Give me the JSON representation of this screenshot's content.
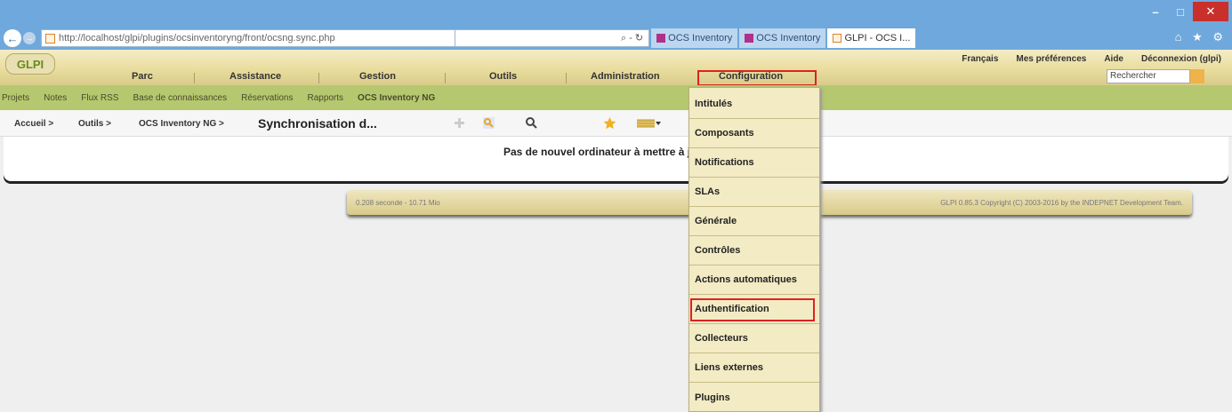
{
  "browser": {
    "url": "http://localhost/glpi/plugins/ocsinventoryng/front/ocsng.sync.php",
    "url_tools": "⌕ - ↻",
    "tabs": [
      "OCS Inventory",
      "OCS Inventory",
      "GLPI - OCS I..."
    ],
    "icons": "⌂ ★ ⚙"
  },
  "header": {
    "logo_text": "GLPI",
    "top_links": [
      "Français",
      "Mes préférences",
      "Aide",
      "Déconnexion (glpi)"
    ],
    "search_placeholder": "Rechercher",
    "main_menu": [
      "Parc",
      "Assistance",
      "Gestion",
      "Outils",
      "Administration",
      "Configuration"
    ]
  },
  "sub_menu": [
    "Projets",
    "Notes",
    "Flux RSS",
    "Base de connaissances",
    "Réservations",
    "Rapports",
    "OCS Inventory NG"
  ],
  "breadcrumb": {
    "items": [
      "Accueil >",
      "Outils >",
      "OCS Inventory NG >"
    ],
    "title": "Synchronisation d..."
  },
  "content": {
    "message": "Pas de nouvel ordinateur à mettre à jour"
  },
  "footer": {
    "left": "0.208 seconde - 10.71 Mio",
    "right": "GLPI 0.85.3 Copyright (C) 2003-2016 by the INDEPNET Development Team."
  },
  "dropdown": {
    "items": [
      "Intitulés",
      "Composants",
      "Notifications",
      "SLAs",
      "Générale",
      "Contrôles",
      "Actions automatiques",
      "Authentification",
      "Collecteurs",
      "Liens externes",
      "Plugins"
    ]
  },
  "colors": {
    "highlight_box": "#dd2222",
    "menu_bar": "#b5c86f",
    "header": "#e9dd9e"
  }
}
